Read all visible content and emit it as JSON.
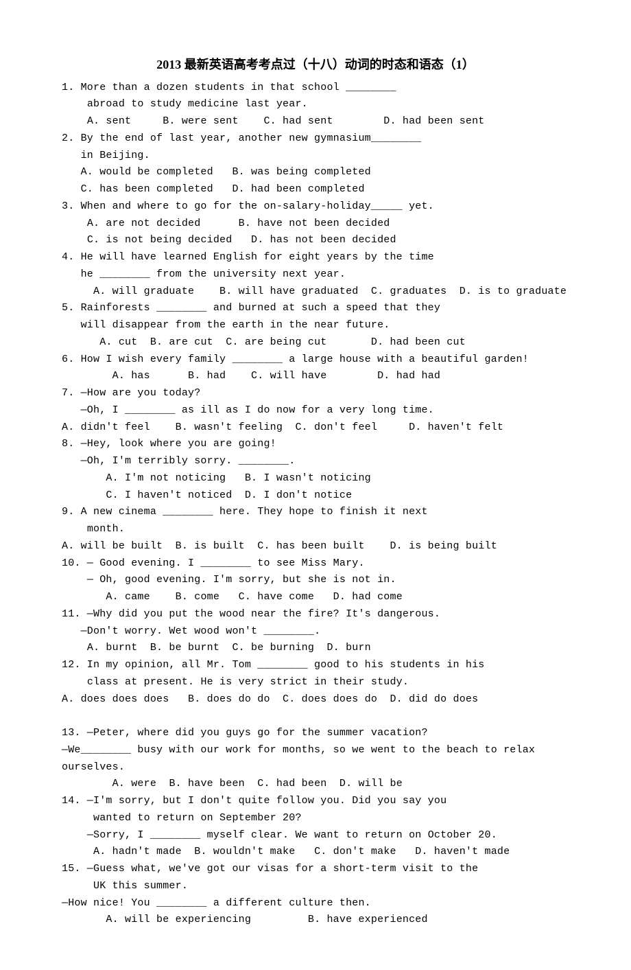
{
  "title": "2013 最新英语高考考点过（十八）动词的时态和语态（1）",
  "questions": [
    {
      "num": "1.",
      "lines": [
        "More than a dozen students in that school ________",
        " abroad to study medicine last year.",
        " A. sent     B. were sent    C. had sent        D. had been sent"
      ]
    },
    {
      "num": "2.",
      "lines": [
        "By the end of last year, another new gymnasium________",
        "in Beijing.",
        "A. would be completed   B. was being completed",
        "C. has been completed   D. had been completed"
      ]
    },
    {
      "num": "3.",
      "lines": [
        "When and where to go for the on-salary-holiday_____ yet.",
        " A. are not decided      B. have not been decided",
        " C. is not being decided   D. has not been decided"
      ]
    },
    {
      "num": "4.",
      "lines": [
        "He will have learned English for eight years by the time",
        "he ________ from the university next year.",
        "  A. will graduate    B. will have graduated  C. graduates  D. is to graduate"
      ]
    },
    {
      "num": "5.",
      "lines": [
        "Rainforests ________ and burned at such a speed that they",
        "will disappear from the earth in the near future.",
        "   A. cut  B. are cut  C. are being cut       D. had been cut"
      ]
    },
    {
      "num": "6.",
      "lines": [
        "How I wish every family ________ a large house with a beautiful garden!",
        "     A. has      B. had    C. will have        D. had had"
      ]
    },
    {
      "num": "7.",
      "lines": [
        "—How are you today?",
        "—Oh, I ________ as ill as I do now for a very long time."
      ],
      "options": "A. didn't feel    B. wasn't feeling  C. don't feel     D. haven't felt"
    },
    {
      "num": "8.",
      "lines": [
        "—Hey, look where you are going!",
        "—Oh, I'm terribly sorry. ________.",
        "    A. I'm not noticing   B. I wasn't noticing",
        "    C. I haven't noticed  D. I don't notice"
      ]
    },
    {
      "num": "9.",
      "lines": [
        "A new cinema ________ here. They hope to finish it next",
        " month."
      ],
      "options": "A. will be built  B. is built  C. has been built    D. is being built"
    },
    {
      "num": "10.",
      "lines": [
        "— Good evening. I ________ to see Miss Mary.",
        " — Oh, good evening. I'm sorry, but she is not in.",
        "    A. came    B. come   C. have come   D. had come"
      ]
    },
    {
      "num": "11.",
      "lines": [
        "—Why did you put the wood near the fire? It's dangerous.",
        "—Don't worry. Wet wood won't ________.",
        " A. burnt  B. be burnt  C. be burning  D. burn"
      ]
    },
    {
      "num": "12.",
      "lines": [
        "In my opinion, all Mr. Tom ________ good to his students in his",
        " class at present. He is very strict in their study."
      ],
      "options": "A. does does does   B. does do do  C. does does do  D. did do does"
    },
    {
      "num": "13.",
      "lines": [
        "—Peter, where did you guys go for the summer vacation?"
      ],
      "flush": "—We________ busy with our work for months, so we went to the beach to relax ourselves.",
      "after": "        A. were  B. have been  C. had been  D. will be"
    },
    {
      "num": "14.",
      "lines": [
        "—I'm sorry, but I don't quite follow you. Did you say you",
        "  wanted to return on September 20?",
        " —Sorry, I ________ myself clear. We want to return on October 20.",
        "  A. hadn't made  B. wouldn't make   C. don't make   D. haven't made"
      ]
    },
    {
      "num": "15.",
      "lines": [
        "—Guess what, we've got our visas for a short-term visit to the",
        "  UK this summer."
      ],
      "flush": "—How nice! You ________ a different culture then.",
      "after": "       A. will be experiencing         B. have experienced"
    }
  ]
}
